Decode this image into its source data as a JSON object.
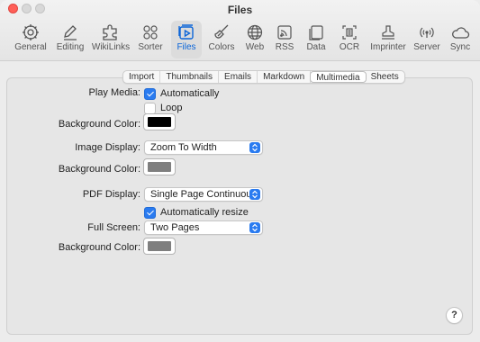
{
  "window": {
    "title": "Files"
  },
  "toolbar": {
    "items": [
      {
        "label": "General",
        "icon": "gear-icon"
      },
      {
        "label": "Editing",
        "icon": "pencil-icon"
      },
      {
        "label": "WikiLinks",
        "icon": "puzzle-icon"
      },
      {
        "label": "Sorter",
        "icon": "grid-circles-icon"
      },
      {
        "label": "Files",
        "icon": "files-icon",
        "active": true
      },
      {
        "label": "Colors",
        "icon": "brush-icon"
      },
      {
        "label": "Web",
        "icon": "globe-icon"
      },
      {
        "label": "RSS",
        "icon": "rss-icon"
      },
      {
        "label": "Data",
        "icon": "data-icon"
      },
      {
        "label": "OCR",
        "icon": "ocr-icon"
      },
      {
        "label": "Imprinter",
        "icon": "stamp-icon"
      },
      {
        "label": "Server",
        "icon": "broadcast-icon"
      },
      {
        "label": "Sync",
        "icon": "cloud-icon"
      }
    ]
  },
  "tabs": [
    "Import",
    "Thumbnails",
    "Emails",
    "Markdown",
    "Multimedia",
    "Sheets"
  ],
  "selected_tab": "Multimedia",
  "form": {
    "play_media_label": "Play Media:",
    "automatically_label": "Automatically",
    "automatically_checked": true,
    "loop_label": "Loop",
    "loop_checked": false,
    "bg_color_label_1": "Background Color:",
    "bg_color_1": "#000000",
    "image_display_label": "Image Display:",
    "image_display_value": "Zoom To Width",
    "bg_color_label_2": "Background Color:",
    "bg_color_2": "#7f7f7f",
    "pdf_display_label": "PDF Display:",
    "pdf_display_value": "Single Page Continuous",
    "auto_resize_label": "Automatically resize",
    "auto_resize_checked": true,
    "full_screen_label": "Full Screen:",
    "full_screen_value": "Two Pages",
    "bg_color_label_3": "Background Color:",
    "bg_color_3": "#7f7f7f"
  },
  "help_label": "?",
  "colors": {
    "accent": "#2a7bf0",
    "close": "#ff5f57"
  }
}
